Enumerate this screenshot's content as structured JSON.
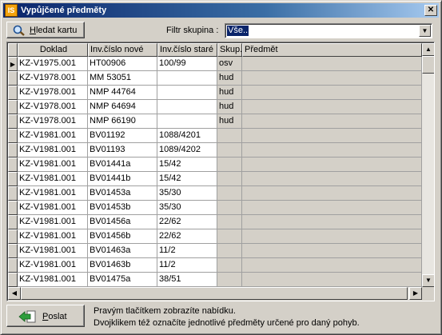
{
  "window": {
    "title": "Vypůjčené předměty",
    "app_icon_text": "IS",
    "close_icon": "close-icon"
  },
  "toolbar": {
    "search_button": {
      "label_mnemonic": "H",
      "label_rest": "ledat kartu",
      "icon": "magnifier-icon"
    },
    "filter_label": "Filtr skupina :",
    "filter_value": "Vše.."
  },
  "table": {
    "columns": [
      "Doklad",
      "Inv.číslo nové",
      "Inv.číslo staré",
      "Skup.",
      "Předmět"
    ],
    "rows": [
      [
        "KZ-V1975.001",
        "HT00906",
        "100/99",
        "osv",
        ""
      ],
      [
        "KZ-V1978.001",
        "MM   53051",
        "",
        "hud",
        ""
      ],
      [
        "KZ-V1978.001",
        "NMP 44764",
        "",
        "hud",
        ""
      ],
      [
        "KZ-V1978.001",
        "NMP 64694",
        "",
        "hud",
        ""
      ],
      [
        "KZ-V1978.001",
        "NMP 66190",
        "",
        "hud",
        ""
      ],
      [
        "KZ-V1981.001",
        "BV01192",
        "1088/4201",
        "",
        ""
      ],
      [
        "KZ-V1981.001",
        "BV01193",
        "1089/4202",
        "",
        ""
      ],
      [
        "KZ-V1981.001",
        "BV01441a",
        "15/42",
        "",
        ""
      ],
      [
        "KZ-V1981.001",
        "BV01441b",
        "15/42",
        "",
        ""
      ],
      [
        "KZ-V1981.001",
        "BV01453a",
        "35/30",
        "",
        ""
      ],
      [
        "KZ-V1981.001",
        "BV01453b",
        "35/30",
        "",
        ""
      ],
      [
        "KZ-V1981.001",
        "BV01456a",
        "22/62",
        "",
        ""
      ],
      [
        "KZ-V1981.001",
        "BV01456b",
        "22/62",
        "",
        ""
      ],
      [
        "KZ-V1981.001",
        "BV01463a",
        "11/2",
        "",
        ""
      ],
      [
        "KZ-V1981.001",
        "BV01463b",
        "11/2",
        "",
        ""
      ],
      [
        "KZ-V1981.001",
        "BV01475a",
        "38/51",
        "",
        ""
      ]
    ],
    "current_row_indicator": "▶"
  },
  "footer": {
    "send_button": {
      "label_mnemonic": "P",
      "label_rest": "oslat",
      "icon": "arrow-left-icon"
    },
    "hint_line1": "Pravým tlačítkem zobrazíte nabídku.",
    "hint_line2": "Dvojklikem též označíte jednotlivé předměty určené pro daný pohyb."
  },
  "colors": {
    "title_bar": "#0a246a",
    "selection": "#0a246a",
    "face": "#d4d0c8"
  }
}
